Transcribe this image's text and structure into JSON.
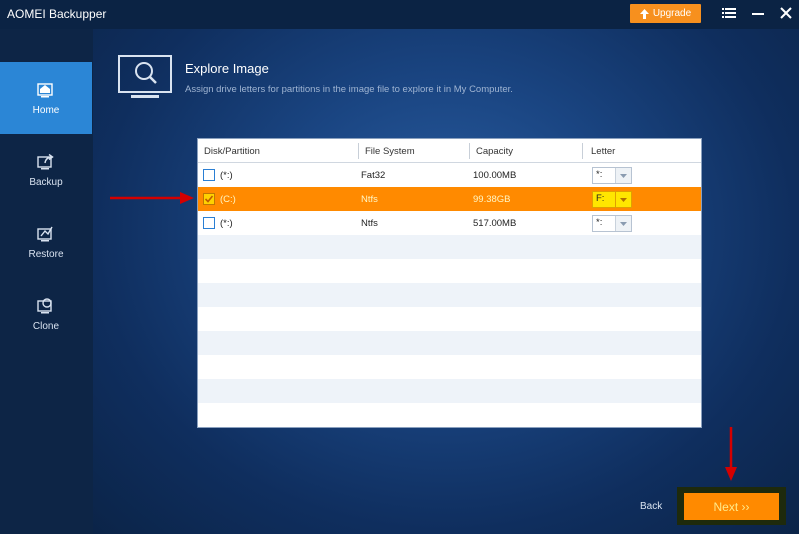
{
  "app": {
    "title": "AOMEI Backupper"
  },
  "titlebar": {
    "upgrade_label": "Upgrade"
  },
  "sidebar": {
    "items": [
      {
        "label": "Home",
        "icon": "home-icon",
        "active": true
      },
      {
        "label": "Backup",
        "icon": "backup-icon",
        "active": false
      },
      {
        "label": "Restore",
        "icon": "restore-icon",
        "active": false
      },
      {
        "label": "Clone",
        "icon": "clone-icon",
        "active": false
      }
    ]
  },
  "header": {
    "title": "Explore Image",
    "subtitle": "Assign drive letters for partitions in the image file to explore it in My Computer."
  },
  "table": {
    "columns": [
      "Disk/Partition",
      "File System",
      "Capacity",
      "Letter"
    ],
    "rows": [
      {
        "partition": "(*:)",
        "fs": "Fat32",
        "capacity": "100.00MB",
        "letter": "*:",
        "checked": false,
        "selected": false
      },
      {
        "partition": "(C:)",
        "fs": "Ntfs",
        "capacity": "99.38GB",
        "letter": "F:",
        "checked": true,
        "selected": true
      },
      {
        "partition": "(*:)",
        "fs": "Ntfs",
        "capacity": "517.00MB",
        "letter": "*:",
        "checked": false,
        "selected": false
      }
    ]
  },
  "footer": {
    "back_label": "Back",
    "next_label": "Next ››"
  },
  "colors": {
    "accent": "#2b86d6",
    "orange": "#ff8a00",
    "annotation_red": "#d40000"
  }
}
